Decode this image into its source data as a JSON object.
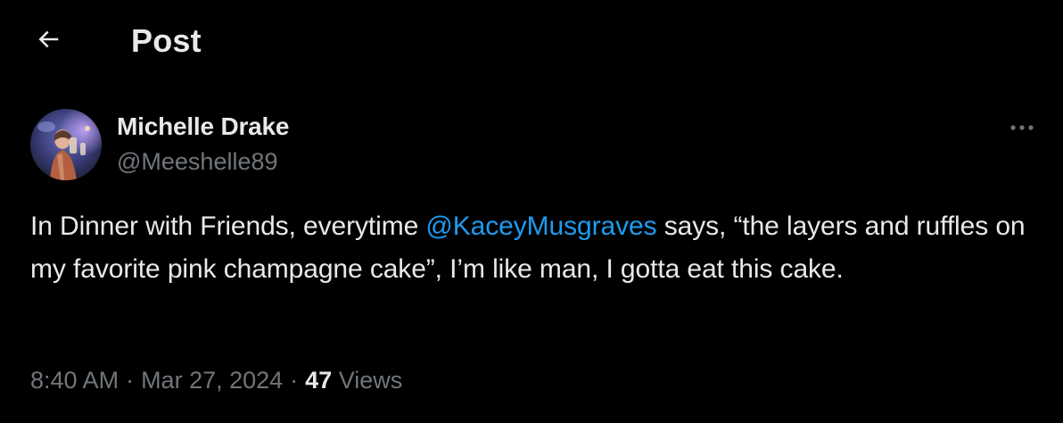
{
  "header": {
    "title": "Post",
    "back_icon": "arrow-left-icon"
  },
  "post": {
    "author": {
      "display_name": "Michelle Drake",
      "handle": "@Meeshelle89",
      "avatar_icon": "profile-photo"
    },
    "more_icon": "ellipsis-icon",
    "text": {
      "before_mention": "In Dinner with Friends, everytime ",
      "mention": "@KaceyMusgraves",
      "after_mention": " says, “the layers and ruffles on my favorite pink champagne cake”, I’m like man, I gotta eat this cake."
    },
    "meta": {
      "time": "8:40 AM",
      "separator": "·",
      "date": "Mar 27, 2024",
      "views_count": "47",
      "views_label": "Views"
    }
  },
  "colors": {
    "background": "#000000",
    "primary_text": "#e7e9ea",
    "secondary_text": "#71767b",
    "link": "#1d9bf0"
  }
}
